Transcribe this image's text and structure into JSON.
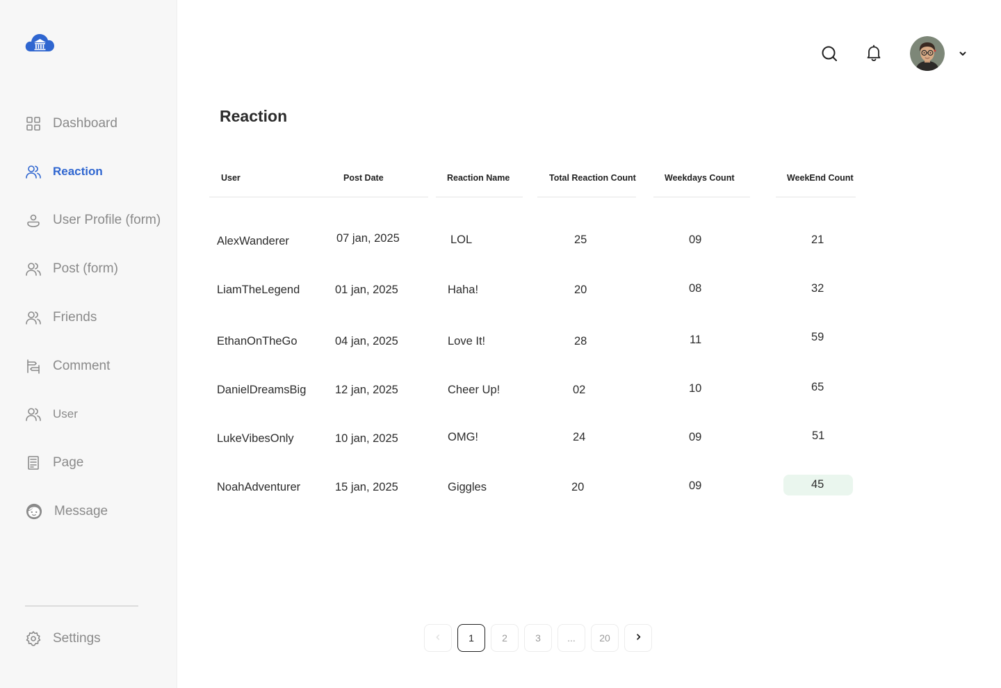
{
  "sidebar": {
    "items": [
      {
        "label": "Dashboard",
        "icon": "grid-icon"
      },
      {
        "label": "Reaction",
        "icon": "users-icon"
      },
      {
        "label": "User Profile (form)",
        "icon": "user-icon"
      },
      {
        "label": "Post (form)",
        "icon": "users-icon"
      },
      {
        "label": "Friends",
        "icon": "users-icon"
      },
      {
        "label": "Comment",
        "icon": "comment-icon"
      },
      {
        "label": "User",
        "icon": "users-icon"
      },
      {
        "label": "Page",
        "icon": "page-icon"
      },
      {
        "label": "Message",
        "icon": "face-icon"
      }
    ],
    "settings_label": "Settings",
    "active_index": 1
  },
  "header": {
    "search_icon": "search-icon",
    "notification_icon": "bell-icon",
    "avatar": "user-avatar",
    "dropdown_icon": "chevron-down-icon"
  },
  "main": {
    "title": "Reaction",
    "table": {
      "columns": [
        "User",
        "Post Date",
        "Reaction Name",
        "Total Reaction Count",
        "Weekdays Count",
        "WeekEnd Count"
      ],
      "rows": [
        [
          "AlexWanderer",
          "07 jan, 2025",
          "LOL",
          "25",
          "09",
          "21"
        ],
        [
          "LiamTheLegend",
          "01 jan, 2025",
          "Haha!",
          "20",
          "08",
          "32"
        ],
        [
          "EthanOnTheGo",
          "04 jan, 2025",
          "Love It!",
          "28",
          "11",
          "59"
        ],
        [
          "DanielDreamsBig",
          "12 jan, 2025",
          "Cheer Up!",
          "02",
          "10",
          "65"
        ],
        [
          "LukeVibesOnly",
          "10 jan, 2025",
          "OMG!",
          "24",
          "09",
          "51"
        ],
        [
          "NoahAdventurer",
          "15 jan, 2025",
          "Giggles",
          "20",
          "09",
          "45"
        ]
      ]
    },
    "pagination": {
      "pages": [
        "1",
        "2",
        "3",
        "...",
        "20"
      ],
      "current": "1"
    }
  },
  "colors": {
    "accent": "#2f66d0",
    "sidebar_bg": "#f7f7f7",
    "highlight_bg": "#eaf6ee"
  }
}
